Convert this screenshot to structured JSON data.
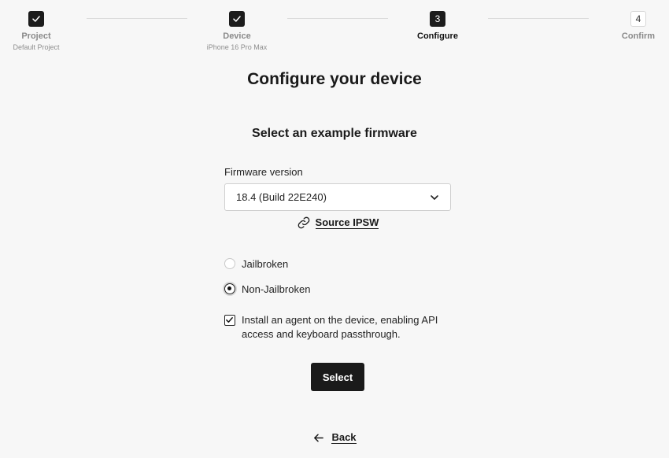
{
  "stepper": {
    "steps": [
      {
        "label": "Project",
        "sub": "Default Project",
        "state": "done",
        "icon": "check-icon"
      },
      {
        "label": "Device",
        "sub": "iPhone 16 Pro Max",
        "state": "done",
        "icon": "check-icon"
      },
      {
        "label": "Configure",
        "number": "3",
        "state": "active"
      },
      {
        "label": "Confirm",
        "number": "4",
        "state": "todo"
      }
    ]
  },
  "page": {
    "title": "Configure your device",
    "section_title": "Select an example firmware"
  },
  "firmware": {
    "label": "Firmware version",
    "selected": "18.4 (Build 22E240)",
    "source_link": "Source IPSW",
    "source_icon": "link-icon",
    "dropdown_icon": "chevron-down-icon"
  },
  "options": {
    "jailbroken": {
      "label": "Jailbroken",
      "checked": false
    },
    "non_jailbroken": {
      "label": "Non-Jailbroken",
      "checked": true
    },
    "agent": {
      "label": "Install an agent on the device, enabling API access and keyboard passthrough.",
      "checked": true
    }
  },
  "actions": {
    "select_label": "Select",
    "back_label": "Back",
    "back_icon": "arrow-left-icon"
  },
  "colors": {
    "background": "#f7f7f7",
    "primary": "#1a1a1a",
    "muted": "#8a8a8a"
  }
}
